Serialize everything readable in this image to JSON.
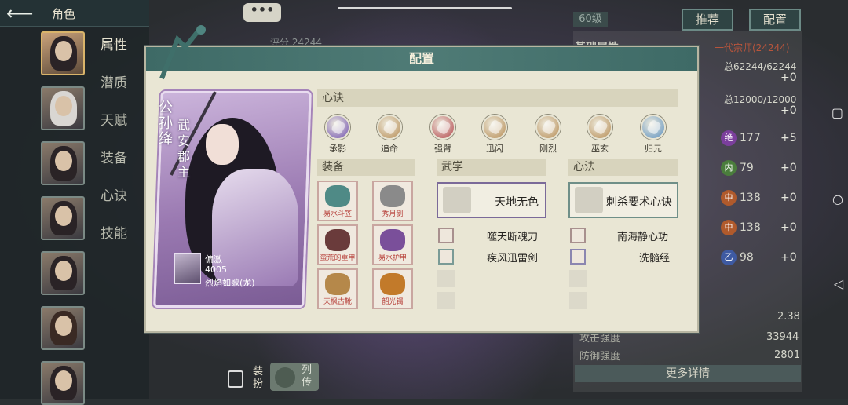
{
  "header": {
    "title": "角色",
    "more": "•••"
  },
  "sidebar": {
    "menu": [
      "属性",
      "潜质",
      "天赋",
      "装备",
      "心诀",
      "技能"
    ],
    "active_index": 0
  },
  "top": {
    "score": "评分 24244",
    "level": "60级",
    "recommend": "推荐",
    "config": "配置"
  },
  "stats_panel": {
    "section": "基础属性",
    "rank": "一代宗师(24244)",
    "hp": "总62244/62244",
    "hp_plus": "+0",
    "mp": "总12000/12000",
    "mp_plus": "+0",
    "rows": [
      {
        "badge": "绝",
        "value": "177",
        "plus": "+5",
        "color": "#7b3f9c"
      },
      {
        "badge": "内",
        "value": "79",
        "plus": "+0",
        "color": "#4a7d3c"
      },
      {
        "badge": "中",
        "value": "138",
        "plus": "+0",
        "color": "#b05a2c"
      },
      {
        "badge": "中",
        "value": "138",
        "plus": "+0",
        "color": "#b05a2c"
      },
      {
        "badge": "乙",
        "value": "98",
        "plus": "+0",
        "color": "#3e5aa2"
      }
    ],
    "ratio": "2.38",
    "attack_label": "攻击强度",
    "attack": "33944",
    "defense_label": "防御强度",
    "defense": "2801",
    "more_detail": "更多详情"
  },
  "bottom": {
    "dress": "装扮",
    "bio": "列传"
  },
  "dialog": {
    "title": "配置",
    "character": {
      "name": "公孙绛",
      "title": "武安郡主",
      "info": [
        "偏激",
        "4005",
        "烈焰如歌(龙)"
      ]
    },
    "xinjue_label": "心诀",
    "skills": [
      {
        "label": "承影",
        "color": "#6f4fb0"
      },
      {
        "label": "追命",
        "color": "#b58a52"
      },
      {
        "label": "强臂",
        "color": "#b2434a"
      },
      {
        "label": "迅闪",
        "color": "#b58a52"
      },
      {
        "label": "刚烈",
        "color": "#b58a52"
      },
      {
        "label": "巫玄",
        "color": "#b58a52"
      },
      {
        "label": "归元",
        "color": "#5a8fc0"
      }
    ],
    "equip_label": "装备",
    "equipment": [
      {
        "label": "易水斗笠",
        "color": "#4f8a86"
      },
      {
        "label": "秀月剑",
        "color": "#8a8a8a"
      },
      {
        "label": "蛮荒的重甲",
        "color": "#6a3b3b"
      },
      {
        "label": "易水护甲",
        "color": "#7a4f9a"
      },
      {
        "label": "天枫古靴",
        "color": "#b5884a"
      },
      {
        "label": "韶光镯",
        "color": "#c27a2a"
      }
    ],
    "wuxue_label": "武学",
    "wuxue_main": "天地无色",
    "wuxue_list": [
      "噬天断魂刀",
      "疾风迅雷剑"
    ],
    "xinfa_label": "心法",
    "xinfa_main": "刺杀要术心诀",
    "xinfa_list": [
      "南海静心功",
      "洗髓经"
    ]
  }
}
